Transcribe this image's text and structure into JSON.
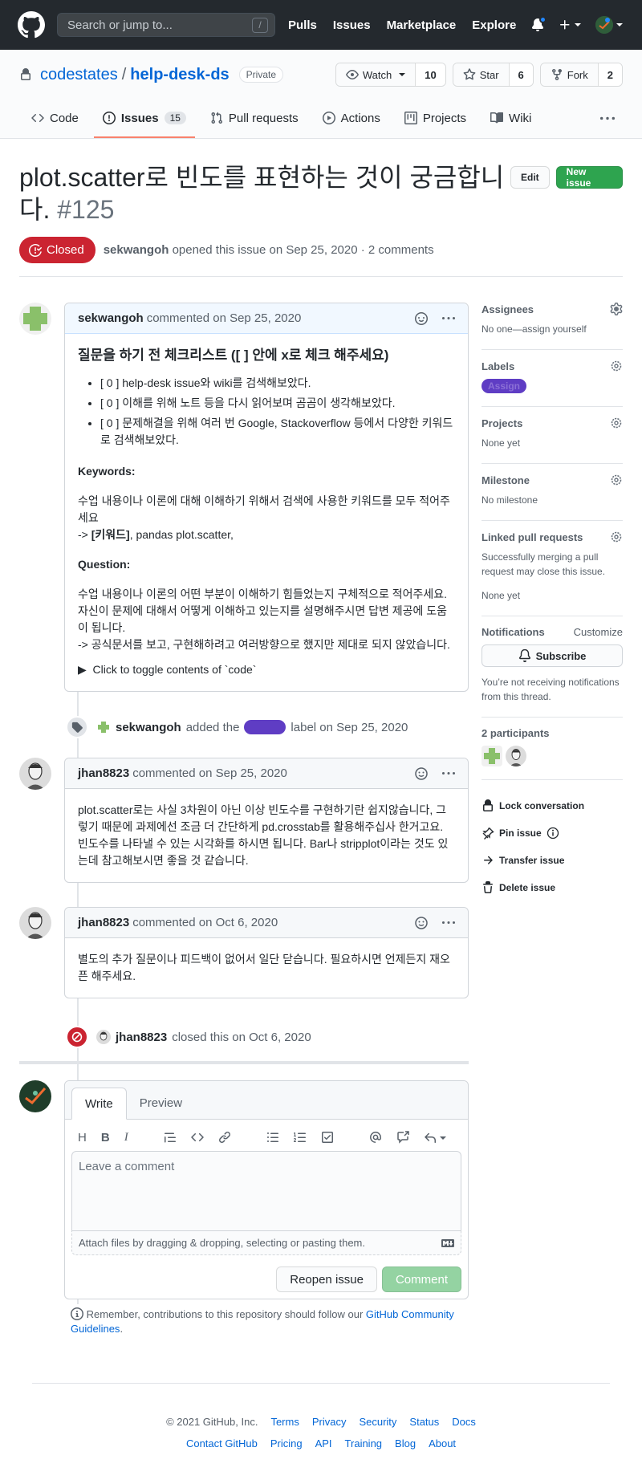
{
  "header": {
    "search_placeholder": "Search or jump to...",
    "search_key": "/",
    "nav": [
      "Pulls",
      "Issues",
      "Marketplace",
      "Explore"
    ]
  },
  "repo": {
    "owner": "codestates",
    "name": "help-desk-ds",
    "visibility": "Private",
    "watch_label": "Watch",
    "watch_count": "10",
    "star_label": "Star",
    "star_count": "6",
    "fork_label": "Fork",
    "fork_count": "2"
  },
  "tabs": {
    "code": "Code",
    "issues": "Issues",
    "issues_count": "15",
    "pulls": "Pull requests",
    "actions": "Actions",
    "projects": "Projects",
    "wiki": "Wiki"
  },
  "issue": {
    "title": "plot.scatter로 빈도를 표현하는 것이 궁금합니다.",
    "number": "#125",
    "edit_label": "Edit",
    "new_issue_label": "New issue",
    "state": "Closed",
    "author": "sekwangoh",
    "meta": "opened this issue on Sep 25, 2020 · 2 comments"
  },
  "comments": {
    "first": {
      "author": "sekwangoh",
      "date": "commented on Sep 25, 2020",
      "heading": "질문을 하기 전 체크리스트 ([ ] 안에 x로 체크 해주세요)",
      "checklist": [
        "[ 0 ] help-desk issue와 wiki를 검색해보았다.",
        "[ 0 ] 이해를 위해 노트 등을 다시 읽어보며 곰곰이 생각해보았다.",
        "[ 0 ] 문제해결을 위해 여러 번 Google, Stackoverflow 등에서 다양한 키워드로 검색해보았다."
      ],
      "keywords_label": "Keywords:",
      "keywords_text1": "수업 내용이나 이론에 대해 이해하기 위해서 검색에 사용한 키워드를 모두 적어주세요",
      "keywords_arrow": "->",
      "keywords_bold": "[키워드]",
      "keywords_rest": ", pandas plot.scatter,",
      "question_label": "Question:",
      "question_text1": "수업 내용이나 이론의 어떤 부분이 이해하기 힘들었는지 구체적으로 적어주세요. 자신이 문제에 대해서 어떻게 이해하고 있는지를 설명해주시면 답변 제공에 도움이 됩니다.",
      "question_text2": "-> 공식문서를 보고, 구현해하려고 여러방향으로 했지만 제대로 되지 않았습니다.",
      "details": "Click to toggle contents of `code`"
    },
    "label_event": {
      "actor": "sekwangoh",
      "text1": "added the",
      "text2": "label on Sep 25, 2020"
    },
    "second": {
      "author": "jhan8823",
      "date": "commented on Sep 25, 2020",
      "body": "plot.scatter로는 사실 3차원이 아닌 이상 빈도수를 구현하기란 쉽지않습니다, 그렇기 때문에 과제에선 조금 더 간단하게 pd.crosstab를 활용해주십사 한거고요. 빈도수를 나타낼 수 있는 시각화를 하시면 됩니다. Bar나 stripplot이라는 것도 있는데 참고해보시면 좋을 것 같습니다."
    },
    "third": {
      "author": "jhan8823",
      "date": "commented on Oct 6, 2020",
      "body": "별도의 추가 질문이나 피드백이 없어서 일단 닫습니다. 필요하시면 언제든지 재오픈 해주세요."
    },
    "close_event": {
      "actor": "jhan8823",
      "text": "closed this on Oct 6, 2020"
    }
  },
  "form": {
    "write_tab": "Write",
    "preview_tab": "Preview",
    "placeholder": "Leave a comment",
    "attach_text": "Attach files by dragging & dropping, selecting or pasting them.",
    "reopen_label": "Reopen issue",
    "comment_label": "Comment",
    "remember_text": "Remember, contributions to this repository should follow our",
    "remember_link": "GitHub Community Guidelines",
    "remember_end": "."
  },
  "sidebar": {
    "assignees_title": "Assignees",
    "assignees_value": "No one—assign yourself",
    "labels_title": "Labels",
    "label_name": "Assign",
    "projects_title": "Projects",
    "projects_value": "None yet",
    "milestone_title": "Milestone",
    "milestone_value": "No milestone",
    "linked_title": "Linked pull requests",
    "linked_desc": "Successfully merging a pull request may close this issue.",
    "linked_value": "None yet",
    "notif_title": "Notifications",
    "notif_customize": "Customize",
    "subscribe_label": "Subscribe",
    "notif_desc": "You’re not receiving notifications from this thread.",
    "participants_title": "2 participants",
    "lock_label": "Lock conversation",
    "pin_label": "Pin issue",
    "transfer_label": "Transfer issue",
    "delete_label": "Delete issue"
  },
  "footer": {
    "copyright": "© 2021 GitHub, Inc.",
    "row1": [
      "Terms",
      "Privacy",
      "Security",
      "Status",
      "Docs"
    ],
    "row2": [
      "Contact GitHub",
      "Pricing",
      "API",
      "Training",
      "Blog",
      "About"
    ]
  },
  "colors": {
    "closed": "#cb2431",
    "label": "#5f3dc4",
    "green": "#2ea44f",
    "link": "#0366d6"
  }
}
